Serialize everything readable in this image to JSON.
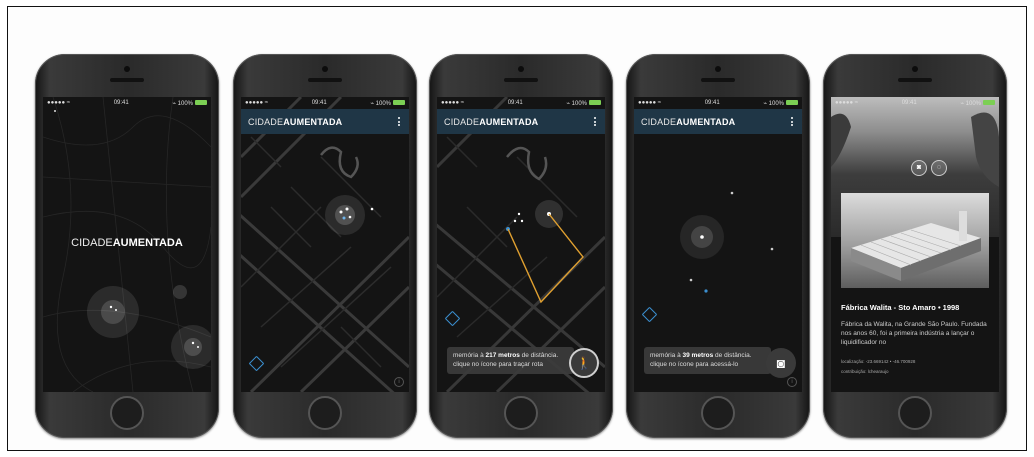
{
  "status_bar": {
    "carrier": "●●●●● ≈",
    "time": "09:41",
    "battery": "⌁ 100%"
  },
  "app_logo": {
    "light": "CIDADE",
    "bold": "AUMENTADA"
  },
  "screen3": {
    "bubble_pre": "memória à ",
    "bubble_bold": "217 metros",
    "bubble_post": " de distância. clique no ícone para traçar rota"
  },
  "screen4": {
    "bubble_pre": "memória à ",
    "bubble_bold": "39 metros",
    "bubble_post": " de distância. clique no ícone para acessá-lo"
  },
  "screen5": {
    "title": "Fábrica Walita - Sto Amaro • 1998",
    "description": "Fábrica da Walita, na Grande São Paulo. Fundada nos anos 60, foi a primeira indústria a lançar o liquidificador no",
    "location": "localização: -23.669142 • -46.700928",
    "contribution": "contribuição: lchearaujo"
  },
  "icons": {
    "info": "i",
    "walk": "🚶",
    "camera": "◙"
  },
  "colors": {
    "appbar": "#1f3646",
    "route": "#e0a030",
    "location": "#3b8fd0"
  }
}
